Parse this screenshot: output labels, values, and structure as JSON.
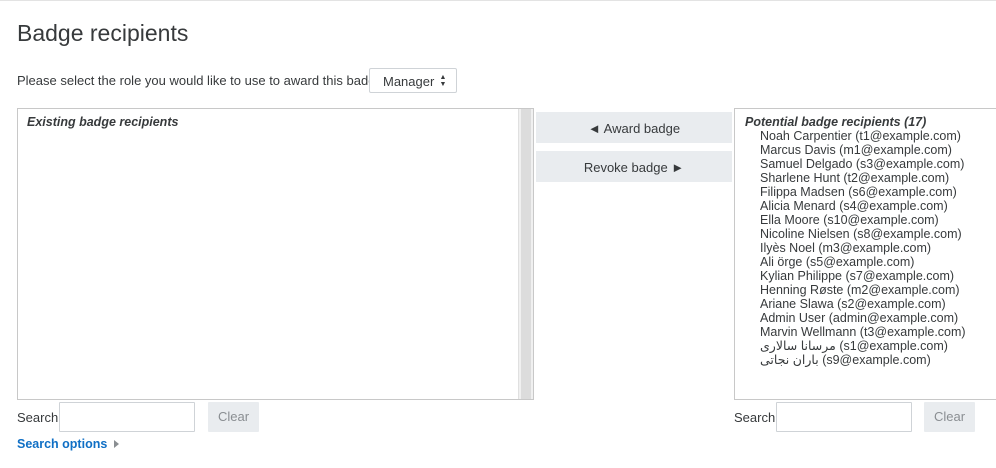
{
  "page": {
    "title": "Badge recipients"
  },
  "role": {
    "label": "Please select the role you would like to use to award this badge:",
    "selected": "Manager",
    "arrow_up": "▲",
    "arrow_down": "▼"
  },
  "existing": {
    "group_label": "Existing badge recipients",
    "items": []
  },
  "actions": {
    "award_label": "◄ Award badge",
    "revoke_label": "Revoke badge ►"
  },
  "potential": {
    "group_label": "Potential badge recipients (17)",
    "items": [
      "Noah Carpentier (t1@example.com)",
      "Marcus Davis (m1@example.com)",
      "Samuel Delgado (s3@example.com)",
      "Sharlene Hunt (t2@example.com)",
      "Filippa Madsen (s6@example.com)",
      "Alicia Menard (s4@example.com)",
      "Ella Moore (s10@example.com)",
      "Nicoline Nielsen (s8@example.com)",
      "Ilyès Noel (m3@example.com)",
      "Ali örge (s5@example.com)",
      "Kylian Philippe (s7@example.com)",
      "Henning Røste (m2@example.com)",
      "Ariane Slawa (s2@example.com)",
      "Admin User (admin@example.com)",
      "Marvin Wellmann (t3@example.com)",
      "مرسانا سالاری (s1@example.com)",
      "باران نجاتی (s9@example.com)"
    ]
  },
  "search_left": {
    "label": "Search",
    "value": "",
    "clear_label": "Clear"
  },
  "search_right": {
    "label": "Search",
    "value": "",
    "clear_label": "Clear"
  },
  "search_options": {
    "label": "Search options"
  }
}
